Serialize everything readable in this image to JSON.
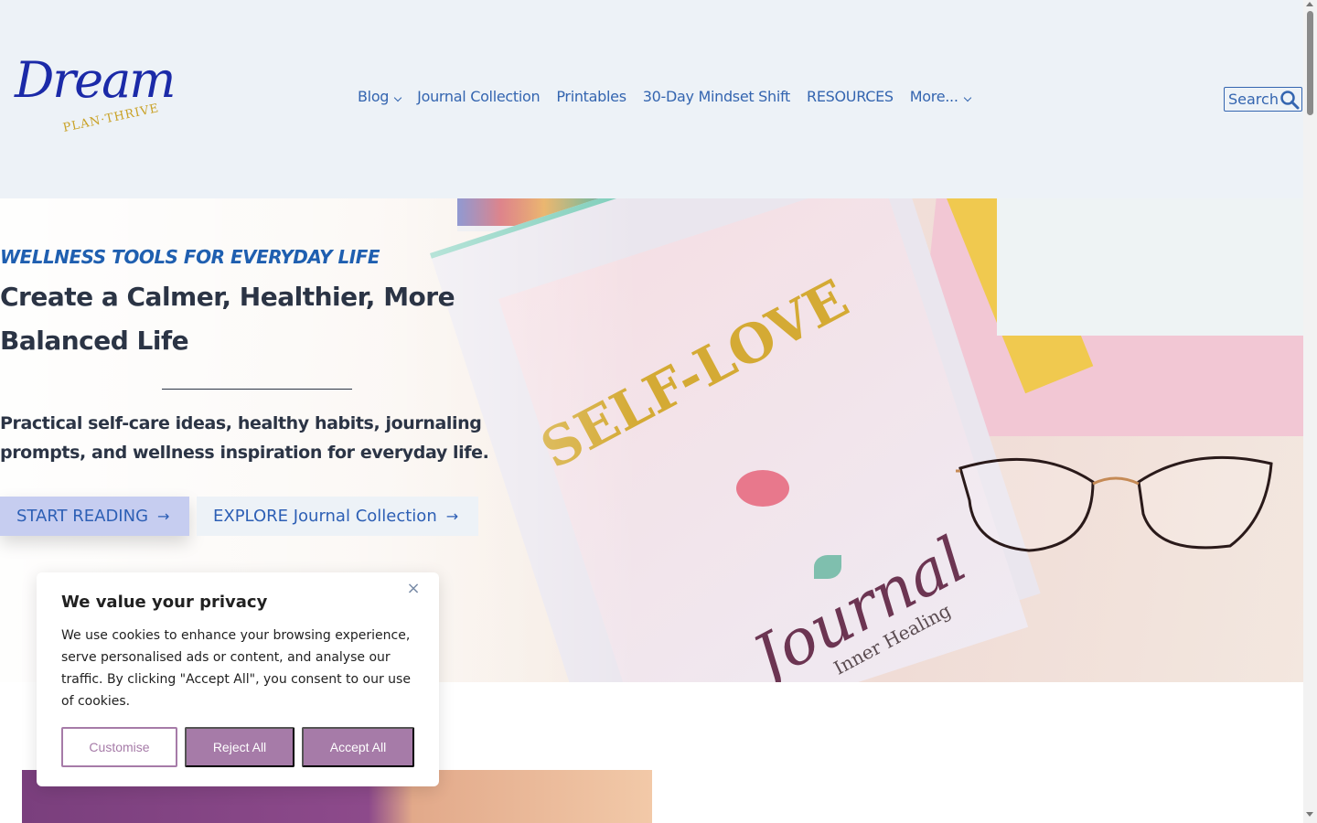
{
  "logo": {
    "word": "Dream",
    "tagline": "PLAN·THRIVE"
  },
  "nav": {
    "items": [
      {
        "label": "Blog",
        "has_dropdown": true
      },
      {
        "label": "Journal Collection",
        "has_dropdown": false
      },
      {
        "label": "Printables",
        "has_dropdown": false
      },
      {
        "label": "30-Day Mindset Shift",
        "has_dropdown": false
      },
      {
        "label": "RESOURCES",
        "has_dropdown": false
      },
      {
        "label": "More...",
        "has_dropdown": true
      }
    ],
    "search_label": "Search",
    "search_icon": "search-icon"
  },
  "hero": {
    "eyebrow": "WELLNESS TOOLS FOR EVERYDAY LIFE",
    "title": "Create a Calmer, Healthier, More Balanced Life",
    "subtitle": "Practical self-care ideas, healthy habits, journaling prompts, and wellness inspiration for everyday life.",
    "primary_button": "START READING",
    "secondary_button": "EXPLORE Journal Collection",
    "image_text": {
      "book_title": "SELF-LOVE",
      "book_word": "Journal",
      "book_sub": "Inner Healing"
    }
  },
  "cookie": {
    "title": "We value your privacy",
    "body": "We use cookies to enhance your browsing experience, serve personalised ads or content, and analyse our traffic. By clicking \"Accept All\", you consent to our use of cookies.",
    "customise": "Customise",
    "reject": "Reject All",
    "accept": "Accept All",
    "close_symbol": "×"
  },
  "colors": {
    "header_bg": "#edf2f7",
    "nav_link": "#3465b0",
    "heading": "#2b3445",
    "eyebrow": "#1f5fb0",
    "cookie_accent": "#a67ba8",
    "primary_btn_bg": "#c6cdf0"
  }
}
